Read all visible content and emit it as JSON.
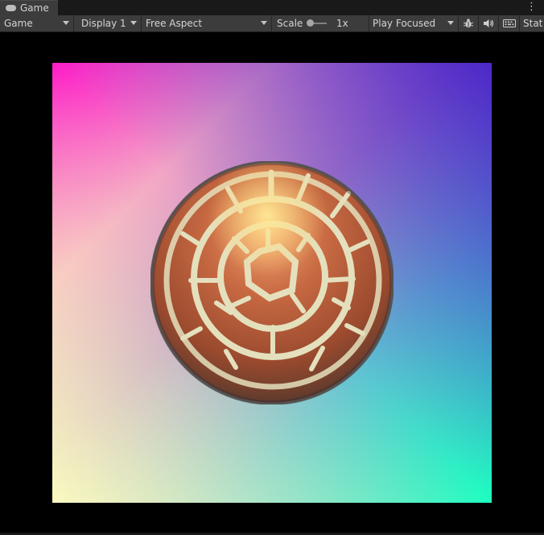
{
  "window": {
    "tab_title": "Game",
    "menu_icon": "kebab-menu-icon"
  },
  "toolbar": {
    "view_select": "Game",
    "display_select": "Display 1",
    "aspect_select": "Free Aspect",
    "scale_label": "Scale",
    "scale_value": "1x",
    "play_mode_select": "Play Focused",
    "bug_icon": "bug-icon",
    "audio_icon": "speaker-icon",
    "keyboard_icon": "keyboard-icon",
    "stats_label": "Stat"
  },
  "colors": {
    "toolbar_bg": "#3c3c3c",
    "viewport_bg": "#000000",
    "gradient_top_left": "#ff1cc8",
    "gradient_top_right": "#3a1fd0",
    "gradient_bottom_left": "#ffffbe",
    "gradient_bottom_right": "#1dffc0",
    "ball_brick": "#b85a36",
    "ball_mortar": "#dcdcb4"
  }
}
